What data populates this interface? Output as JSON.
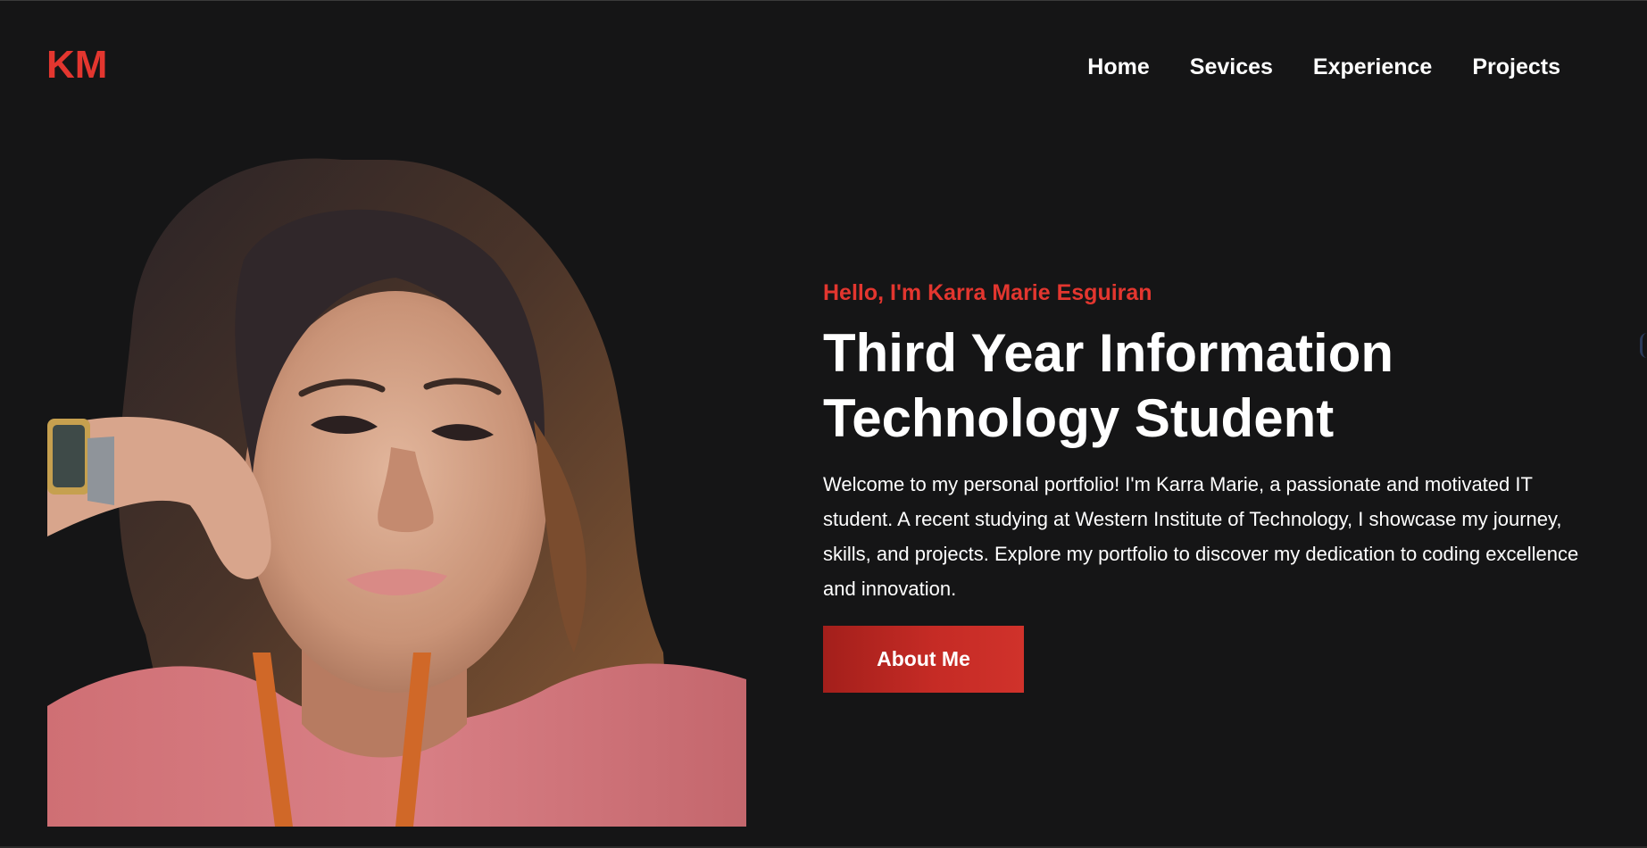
{
  "logo": {
    "text": "KM",
    "color": "#e3362f"
  },
  "nav": {
    "items": [
      {
        "label": "Home"
      },
      {
        "label": "Sevices"
      },
      {
        "label": "Experience"
      },
      {
        "label": "Projects"
      }
    ]
  },
  "hero": {
    "greeting": "Hello, I'm Karra Marie Esguiran",
    "headline": "Third Year Information Technology Student",
    "intro": "Welcome to my personal portfolio! I'm Karra Marie, a passionate and motivated IT student. A recent studying at Western Institute of Technology, I showcase my journey, skills, and projects. Explore my portfolio to discover my dedication to coding excellence and innovation.",
    "button_label": "About Me",
    "photo_icon": "portrait-photo"
  },
  "colors": {
    "background": "#151516",
    "accent": "#e3362f",
    "button": "#c52b25",
    "text": "#ffffff"
  }
}
